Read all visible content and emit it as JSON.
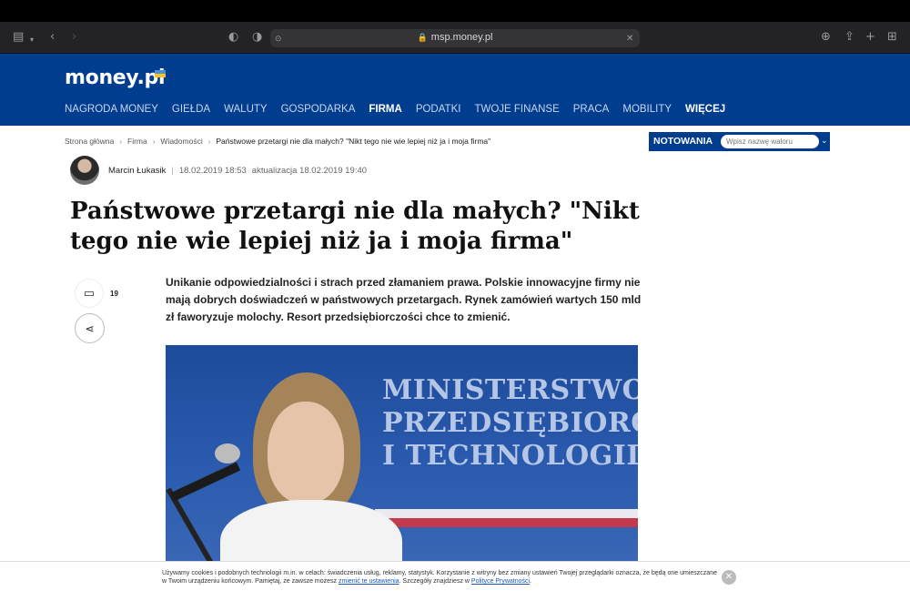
{
  "browser": {
    "url": "msp.money.pl",
    "icons": {
      "sidebar": "sidebar-icon",
      "back": "back-icon",
      "forward": "forward-icon",
      "shield": "shield-icon",
      "download": "download-icon",
      "share": "share-icon",
      "new_tab": "plus-icon",
      "tabs": "tabs-grid-icon"
    }
  },
  "site": {
    "logo": "money.pl",
    "nav": [
      {
        "label": "NAGRODA MONEY",
        "bold": false
      },
      {
        "label": "GIEŁDA",
        "bold": false
      },
      {
        "label": "WALUTY",
        "bold": false
      },
      {
        "label": "GOSPODARKA",
        "bold": false
      },
      {
        "label": "FIRMA",
        "bold": true
      },
      {
        "label": "PODATKI",
        "bold": false
      },
      {
        "label": "TWOJE FINANSE",
        "bold": false
      },
      {
        "label": "PRACA",
        "bold": false
      },
      {
        "label": "MOBILITY",
        "bold": false
      },
      {
        "label": "WIĘCEJ",
        "bold": true
      }
    ],
    "colors": {
      "brand": "#003d8f"
    }
  },
  "breadcrumb": {
    "items": [
      "Strona główna",
      "Firma",
      "Wiadomości"
    ],
    "current": "Państwowe przetargi nie dla małych? \"Nikt tego nie wie lepiej niż ja i moja firma\""
  },
  "article": {
    "author": "Marcin Łukasik",
    "separator": "|",
    "published": "18.02.2019 18:53",
    "updated": "aktualizacja 18.02.2019 19:40",
    "title": "Państwowe przetargi nie dla małych? \"Nikt tego nie wie lepiej niż ja i moja firma\"",
    "lead": "Unikanie odpowiedzialności i strach przed złamaniem prawa. Polskie innowacyjne firmy nie mają dobrych doświadczeń w państwowych przetargach. Rynek zamówień wartych 150 mld zł faworyzuje molochy. Resort przedsiębiorczości chce to zmienić.",
    "comments_count": "19",
    "image_text": [
      "MINISTERSTWO",
      "PRZEDSIĘBIORCZ",
      "I TECHNOLOGII"
    ]
  },
  "notowania": {
    "label": "NOTOWANIA",
    "placeholder": "Wpisz nazwę waloru"
  },
  "cookie": {
    "text_before": "Używamy cookies i podobnych technologii m.in. w celach: świadczenia usług, reklamy, statystyk. Korzystanie z witryny bez zmiany ustawień Twojej przeglądarki oznacza, że będą one umieszczane w Twoim urządzeniu końcowym. Pamiętaj, że zawsze możesz ",
    "link1": "zmienić te ustawienia",
    "text_middle": ". Szczegóły znajdziesz w ",
    "link2": "Polityce Prywatności",
    "text_after": "."
  }
}
